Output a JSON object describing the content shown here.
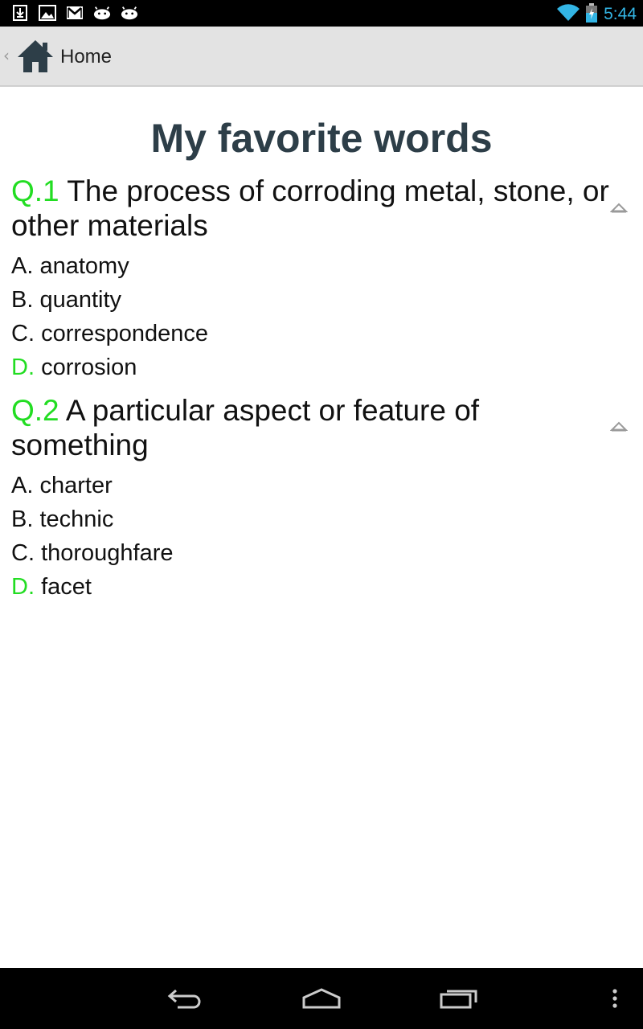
{
  "status_bar": {
    "time": "5:44",
    "icons": [
      "download-icon",
      "gallery-icon",
      "gmail-icon",
      "android-icon",
      "android-icon",
      "wifi-icon",
      "battery-charging-icon"
    ]
  },
  "action_bar": {
    "title": "Home"
  },
  "page": {
    "title": "My favorite words"
  },
  "questions": [
    {
      "number": "Q.1",
      "text": "The process of corroding metal, stone, or other materials",
      "options": [
        {
          "letter": "A.",
          "text": "anatomy"
        },
        {
          "letter": "B.",
          "text": "quantity"
        },
        {
          "letter": "C.",
          "text": "correspondence"
        },
        {
          "letter": "D.",
          "text": "corrosion"
        }
      ]
    },
    {
      "number": "Q.2",
      "text": "A particular aspect or feature of something",
      "options": [
        {
          "letter": "A.",
          "text": "charter"
        },
        {
          "letter": "B.",
          "text": "technic"
        },
        {
          "letter": "C.",
          "text": "thoroughfare"
        },
        {
          "letter": "D.",
          "text": "facet"
        }
      ]
    }
  ],
  "colors": {
    "accent_correct": "#22dd22",
    "title": "#2d3e48",
    "status_time": "#33b5e5",
    "action_bar_bg": "#e3e3e3"
  }
}
